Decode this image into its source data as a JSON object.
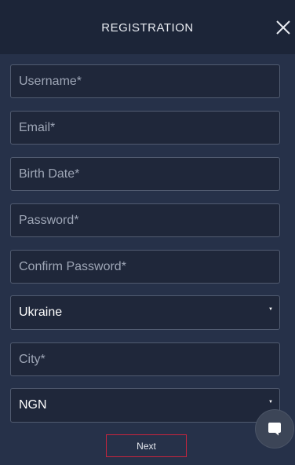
{
  "header": {
    "title": "REGISTRATION"
  },
  "form": {
    "username_placeholder": "Username*",
    "email_placeholder": "Email*",
    "birthdate_placeholder": "Birth Date*",
    "password_placeholder": "Password*",
    "confirm_password_placeholder": "Confirm Password*",
    "country_value": "Ukraine",
    "city_placeholder": "City*",
    "currency_value": "NGN",
    "caret_glyph": "▼",
    "next_label": "Next"
  },
  "icons": {
    "close": "close-icon",
    "chat": "chat-icon"
  },
  "colors": {
    "header_bg": "#1c2538",
    "page_bg": "#263149",
    "field_bg": "#1f273a",
    "field_border": "#515b70",
    "accent_border": "#c8243d"
  }
}
